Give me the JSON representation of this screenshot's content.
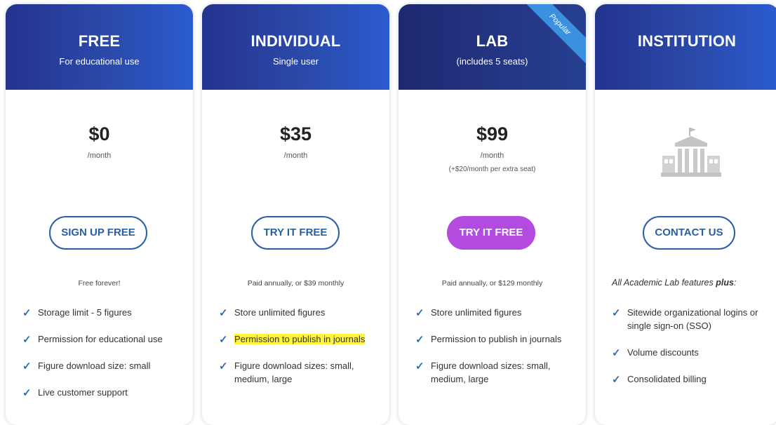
{
  "plans": [
    {
      "title": "FREE",
      "subtitle": "For educational use",
      "price": "$0",
      "period": "/month",
      "button": "SIGN UP FREE",
      "note": "Free forever!",
      "features": [
        "Storage limit - 5 figures",
        "Permission for educational use",
        "Figure download size: small",
        "Live customer support"
      ]
    },
    {
      "title": "INDIVIDUAL",
      "subtitle": "Single user",
      "price": "$35",
      "period": "/month",
      "button": "TRY IT FREE",
      "note": "Paid annually, or $39 monthly",
      "features": [
        "Store unlimited figures",
        "Permission to publish in journals",
        "Figure download sizes: small, medium, large"
      ]
    },
    {
      "title": "LAB",
      "subtitle": "(includes 5 seats)",
      "ribbon": "Popular",
      "price": "$99",
      "period": "/month",
      "extra": "(+$20/month per extra seat)",
      "button": "TRY IT FREE",
      "note": "Paid annually, or $129 monthly",
      "features": [
        "Store unlimited figures",
        "Permission to publish in journals",
        "Figure download sizes: small, medium, large"
      ]
    },
    {
      "title": "INSTITUTION",
      "button": "CONTACT US",
      "note_prefix": "All Academic Lab features ",
      "note_bold": "plus",
      "note_suffix": ":",
      "features": [
        "Sitewide organizational logins or single sign-on (SSO)",
        "Volume discounts",
        "Consolidated billing"
      ]
    }
  ],
  "colors": {
    "header_blue": "#2b4aa9",
    "header_dark": "#243685",
    "ribbon": "#3b91e0",
    "button_outline": "#2c5ea6",
    "button_primary": "#b34be0",
    "check": "#2d6fb7",
    "highlight": "#fff33d"
  },
  "icons": {
    "check": "checkmark-icon",
    "institution": "building-icon"
  }
}
